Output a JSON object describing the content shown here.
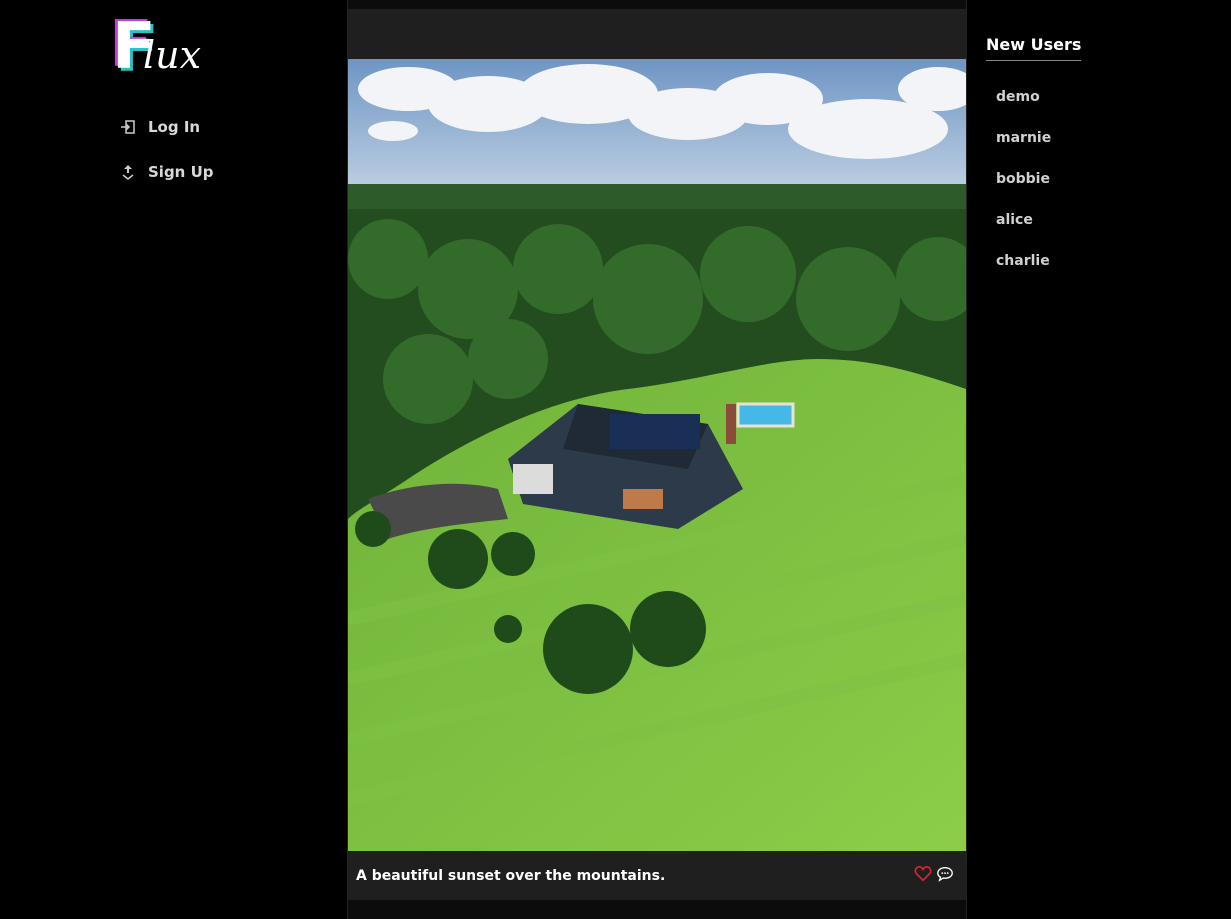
{
  "brand": {
    "logo_initial": "F",
    "logo_rest": "lux"
  },
  "nav": [
    {
      "label": "Log In",
      "icon": "login-icon"
    },
    {
      "label": "Sign Up",
      "icon": "signup-icon"
    }
  ],
  "post": {
    "caption": "A beautiful sunset over the mountains.",
    "like_icon": "heart-icon",
    "comment_icon": "comment-icon"
  },
  "new_users": {
    "title": "New Users",
    "users": [
      "demo",
      "marnie",
      "bobbie",
      "alice",
      "charlie"
    ]
  },
  "colors": {
    "accent_pink": "#c23be0",
    "accent_teal": "#29c3c6",
    "like_red": "#e0242e",
    "card_bg": "#1f1f1f"
  }
}
